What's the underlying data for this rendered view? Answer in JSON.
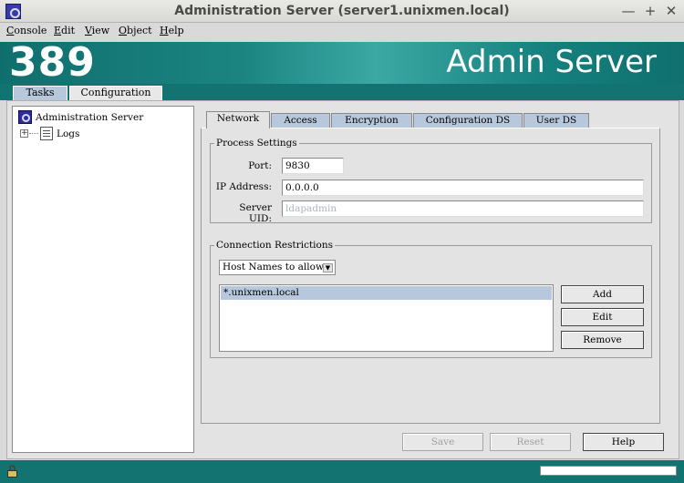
{
  "window": {
    "title": "Administration Server (server1.unixmen.local)",
    "controls": [
      "—",
      "+",
      "✕"
    ]
  },
  "menu": [
    "Console",
    "Edit",
    "View",
    "Object",
    "Help"
  ],
  "banner": {
    "number": "389",
    "product": "Admin Server"
  },
  "console_tabs": [
    "Tasks",
    "Configuration"
  ],
  "tree": {
    "root": "Administration Server",
    "children": [
      "Logs"
    ]
  },
  "subtabs": [
    "Network",
    "Access",
    "Encryption",
    "Configuration DS",
    "User DS"
  ],
  "process_settings": {
    "title": "Process Settings",
    "port_label": "Port:",
    "port_value": "9830",
    "ip_label": "IP Address:",
    "ip_value": "0.0.0.0",
    "uid_label": "Server UID:",
    "uid_value": "ldapadmin"
  },
  "connection": {
    "title": "Connection Restrictions",
    "select_value": "Host Names to allow",
    "list": [
      "*.unixmen.local"
    ],
    "add": "Add",
    "edit": "Edit",
    "remove": "Remove"
  },
  "footer_buttons": {
    "save": "Save",
    "reset": "Reset",
    "help": "Help"
  },
  "icons": {
    "app": "app-icon",
    "server": "server-icon",
    "logs": "logs-icon",
    "lock": "lock-icon"
  },
  "colors": {
    "banner": "#137371",
    "tab_inactive": "#b7c8dd",
    "selection": "#b7c8dd"
  }
}
